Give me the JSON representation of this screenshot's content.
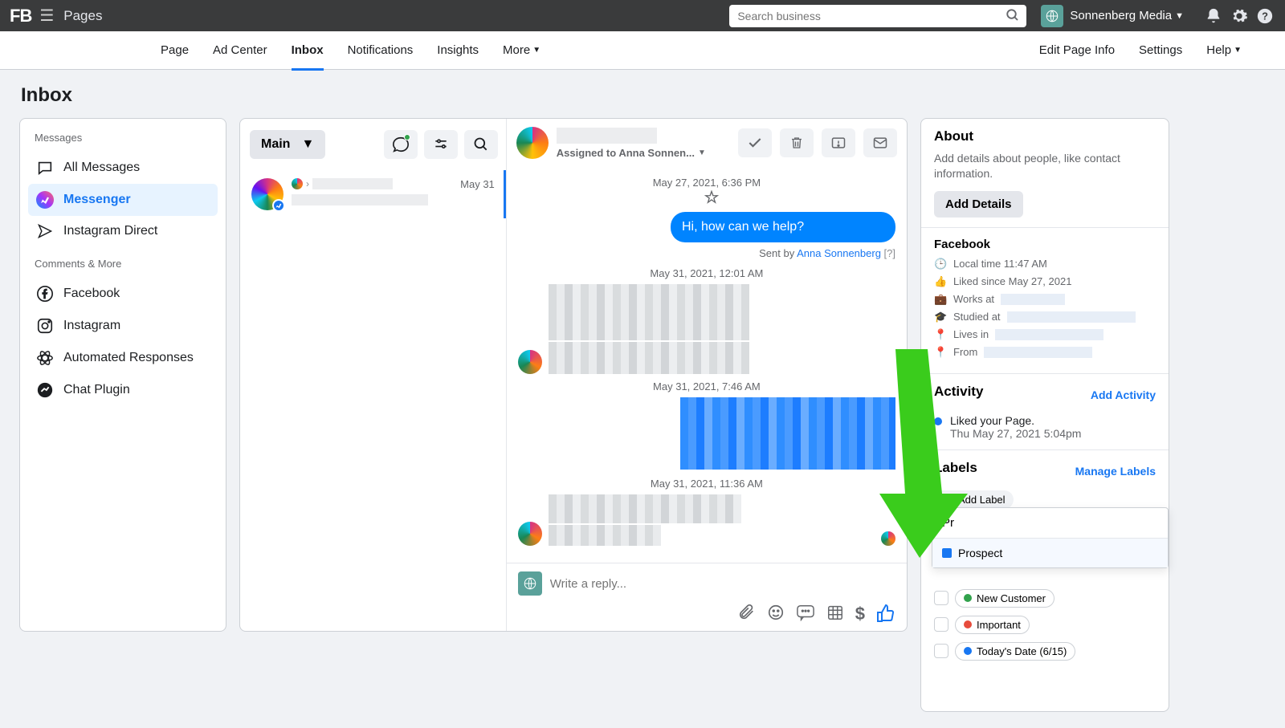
{
  "topbar": {
    "logo": "FB",
    "pages": "Pages",
    "search_placeholder": "Search business",
    "business_name": "Sonnenberg Media"
  },
  "secnav": {
    "tabs": [
      "Page",
      "Ad Center",
      "Inbox",
      "Notifications",
      "Insights",
      "More"
    ],
    "active_index": 2,
    "right": [
      "Edit Page Info",
      "Settings",
      "Help"
    ]
  },
  "page_title": "Inbox",
  "left": {
    "messages_header": "Messages",
    "comments_header": "Comments & More",
    "items_top": [
      "All Messages",
      "Messenger",
      "Instagram Direct"
    ],
    "items_bottom": [
      "Facebook",
      "Instagram",
      "Automated Responses",
      "Chat Plugin"
    ],
    "active_top_index": 1
  },
  "midlist": {
    "main_dd": "Main",
    "convo_date": "May 31"
  },
  "conv": {
    "assigned": "Assigned to Anna Sonnen...",
    "ts1": "May 27, 2021, 6:36 PM",
    "bubble1": "Hi, how can we help?",
    "sentby_prefix": "Sent by ",
    "sentby_name": "Anna Sonnenberg",
    "sentby_q": " [?]",
    "ts2": "May 31, 2021, 12:01 AM",
    "ts3": "May 31, 2021, 7:46 AM",
    "ts4": "May 31, 2021, 11:36 AM",
    "reply_placeholder": "Write a reply...",
    "dollar": "$"
  },
  "rpanel": {
    "about": "About",
    "about_desc": "Add details about people, like contact information.",
    "add_details": "Add Details",
    "facebook": "Facebook",
    "local_time": "Local time 11:47 AM",
    "liked_since": "Liked since May 27, 2021",
    "works_at": "Works at ",
    "studied_at": "Studied at ",
    "lives_in": "Lives in ",
    "from": "From ",
    "activity": "Activity",
    "add_activity": "Add Activity",
    "activity_t1": "Liked your Page.",
    "activity_t2": "Thu May 27, 2021 5:04pm",
    "labels": "Labels",
    "manage_labels": "Manage Labels",
    "add_label": "Add Label",
    "label_new_customer": "New Customer",
    "label_important": "Important",
    "label_today": "Today's Date (6/15)",
    "dd_input": "Pr",
    "dd_opt": "Prospect"
  }
}
